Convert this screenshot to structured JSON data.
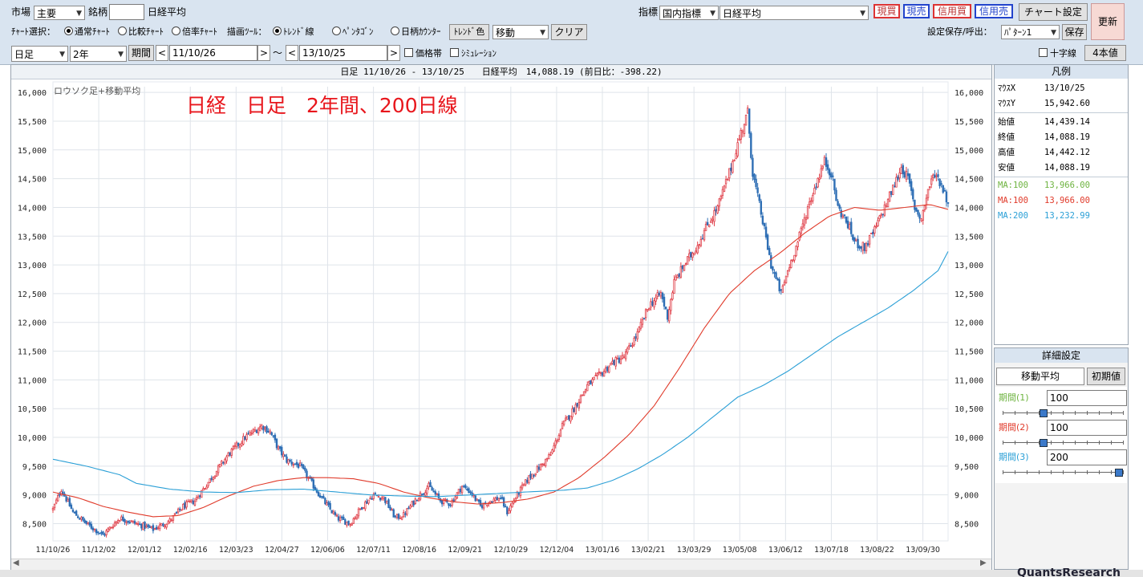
{
  "toolbar1": {
    "market_label": "市場",
    "market_value": "主要",
    "symbol_label": "銘柄",
    "symbol_value": "",
    "symbol_name": "日経平均",
    "indicator_label": "指標",
    "indicator_category": "国内指標",
    "indicator_value": "日経平均",
    "buttons": [
      "現買",
      "現売",
      "信用買",
      "信用売"
    ],
    "chart_settings": "チャート設定",
    "refresh": "更新"
  },
  "toolbar2": {
    "chart_select_label": "ﾁｬｰﾄ選択：",
    "chart_modes": [
      "通常ﾁｬｰﾄ",
      "比較ﾁｬｰﾄ",
      "倍率ﾁｬｰﾄ"
    ],
    "draw_tool_label": "描画ﾂｰﾙ：",
    "draw_tools": [
      "ﾄﾚﾝﾄﾞ線",
      "ﾍﾟﾝﾀｺﾞﾝ",
      "日柄ｶｳﾝﾀｰ"
    ],
    "trend_color": "ﾄﾚﾝﾄﾞ色",
    "mode_value": "移動",
    "clear": "クリア",
    "save_label": "設定保存/呼出：",
    "pattern_value": "ﾊﾟﾀｰﾝ1",
    "save_button": "保存"
  },
  "toolbar3": {
    "bar_type": "日足",
    "span": "2年",
    "period_button": "期間",
    "prev": "<",
    "next": ">",
    "start_date": "11/10/26",
    "tilde": "～",
    "end_date": "13/10/25",
    "price_band": "価格帯",
    "simulation": "ｼﾐｭﾚｰｼｮﾝ",
    "crosshair": "十字線",
    "four_values": "4本値"
  },
  "chart_header": "日足 11/10/26 - 13/10/25　　日経平均　14,088.19 (前日比：-398.22)",
  "chart_type_label": "ロウソク足+移動平均",
  "annotation": "日経　日足　2年間、200日線",
  "legend": {
    "title": "凡例",
    "mouse_x_label": "ﾏｳｽX",
    "mouse_x": "13/10/25",
    "mouse_y_label": "ﾏｳｽY",
    "mouse_y": "15,942.60",
    "open_label": "始値",
    "open": "14,439.14",
    "close_label": "終値",
    "close": "14,088.19",
    "high_label": "高値",
    "high": "14,442.12",
    "low_label": "安値",
    "low": "14,088.19",
    "ma1_label": "MA:100",
    "ma1": "13,966.00",
    "ma1_color": "#6db33f",
    "ma2_label": "MA:100",
    "ma2": "13,966.00",
    "ma2_color": "#e03a2a",
    "ma3_label": "MA:200",
    "ma3": "13,232.99",
    "ma3_color": "#2a9fd6"
  },
  "details": {
    "title": "詳細設定",
    "tab": "移動平均",
    "reset": "初期値",
    "period1_label": "期間(1)",
    "period1": "100",
    "period2_label": "期間(2)",
    "period2": "100",
    "period3_label": "期間(3)",
    "period3": "200",
    "period1_color": "#6db33f",
    "period2_color": "#e03a2a",
    "period3_color": "#2a9fd6",
    "slider1": 0.33,
    "slider2": 0.33,
    "slider3": 1.0
  },
  "bottom_watermark": "QuantsResearch",
  "chart_data": {
    "type": "candlestick",
    "ylim": [
      8200,
      16100
    ],
    "yticks": [
      8500,
      9000,
      9500,
      10000,
      10500,
      11000,
      11500,
      12000,
      12500,
      13000,
      13500,
      14000,
      14500,
      15000,
      15500,
      16000
    ],
    "ytick_labels": [
      "8,500",
      "9,000",
      "9,500",
      "10,000",
      "10,500",
      "11,000",
      "11,500",
      "12,000",
      "12,500",
      "13,000",
      "13,500",
      "14,000",
      "14,500",
      "15,000",
      "15,500",
      "16,000"
    ],
    "xtick_labels": [
      "11/10/26",
      "11/12/02",
      "12/01/12",
      "12/02/16",
      "12/03/23",
      "12/04/27",
      "12/06/06",
      "12/07/11",
      "12/08/16",
      "12/09/21",
      "12/10/29",
      "12/12/04",
      "13/01/16",
      "13/02/21",
      "13/03/29",
      "13/05/08",
      "13/06/12",
      "13/07/18",
      "13/08/22",
      "13/09/30"
    ],
    "close_path": [
      [
        0,
        8750
      ],
      [
        5,
        9100
      ],
      [
        12,
        8700
      ],
      [
        20,
        8500
      ],
      [
        30,
        8300
      ],
      [
        40,
        8600
      ],
      [
        50,
        8500
      ],
      [
        60,
        8400
      ],
      [
        70,
        8550
      ],
      [
        78,
        8800
      ],
      [
        85,
        8900
      ],
      [
        95,
        9300
      ],
      [
        105,
        9700
      ],
      [
        115,
        10000
      ],
      [
        125,
        10200
      ],
      [
        130,
        10100
      ],
      [
        135,
        9800
      ],
      [
        140,
        9600
      ],
      [
        148,
        9500
      ],
      [
        155,
        9200
      ],
      [
        162,
        8900
      ],
      [
        170,
        8600
      ],
      [
        178,
        8500
      ],
      [
        185,
        8800
      ],
      [
        192,
        9000
      ],
      [
        198,
        8950
      ],
      [
        205,
        8600
      ],
      [
        210,
        8650
      ],
      [
        218,
        8950
      ],
      [
        225,
        9150
      ],
      [
        232,
        8900
      ],
      [
        238,
        8850
      ],
      [
        245,
        9150
      ],
      [
        250,
        9050
      ],
      [
        256,
        8800
      ],
      [
        262,
        8900
      ],
      [
        268,
        8950
      ],
      [
        272,
        8700
      ],
      [
        278,
        9000
      ],
      [
        285,
        9300
      ],
      [
        292,
        9500
      ],
      [
        298,
        9700
      ],
      [
        305,
        10200
      ],
      [
        312,
        10500
      ],
      [
        320,
        10900
      ],
      [
        328,
        11100
      ],
      [
        335,
        11300
      ],
      [
        342,
        11400
      ],
      [
        350,
        11800
      ],
      [
        357,
        12300
      ],
      [
        364,
        12500
      ],
      [
        368,
        12100
      ],
      [
        372,
        12700
      ],
      [
        378,
        13000
      ],
      [
        385,
        13300
      ],
      [
        392,
        13700
      ],
      [
        398,
        14000
      ],
      [
        405,
        14600
      ],
      [
        412,
        15300
      ],
      [
        416,
        15650
      ],
      [
        419,
        14600
      ],
      [
        424,
        13900
      ],
      [
        430,
        13000
      ],
      [
        436,
        12500
      ],
      [
        440,
        12900
      ],
      [
        446,
        13400
      ],
      [
        452,
        14000
      ],
      [
        458,
        14500
      ],
      [
        462,
        14800
      ],
      [
        466,
        14600
      ],
      [
        470,
        14000
      ],
      [
        476,
        13700
      ],
      [
        480,
        13400
      ],
      [
        486,
        13300
      ],
      [
        492,
        13600
      ],
      [
        498,
        14000
      ],
      [
        504,
        14400
      ],
      [
        508,
        14700
      ],
      [
        512,
        14500
      ],
      [
        516,
        14000
      ],
      [
        520,
        13800
      ],
      [
        524,
        14300
      ],
      [
        528,
        14600
      ],
      [
        532,
        14400
      ],
      [
        536,
        14088
      ]
    ],
    "series": [
      {
        "name": "MA:100",
        "color": "#e03a2a",
        "points": [
          [
            0,
            9050
          ],
          [
            15,
            8950
          ],
          [
            30,
            8800
          ],
          [
            45,
            8700
          ],
          [
            60,
            8620
          ],
          [
            75,
            8640
          ],
          [
            90,
            8780
          ],
          [
            105,
            8980
          ],
          [
            120,
            9150
          ],
          [
            135,
            9250
          ],
          [
            150,
            9300
          ],
          [
            165,
            9300
          ],
          [
            180,
            9280
          ],
          [
            195,
            9200
          ],
          [
            210,
            9050
          ],
          [
            225,
            8950
          ],
          [
            240,
            8880
          ],
          [
            255,
            8840
          ],
          [
            270,
            8870
          ],
          [
            285,
            8930
          ],
          [
            300,
            9050
          ],
          [
            315,
            9300
          ],
          [
            330,
            9650
          ],
          [
            345,
            10050
          ],
          [
            360,
            10550
          ],
          [
            375,
            11200
          ],
          [
            390,
            11900
          ],
          [
            405,
            12500
          ],
          [
            420,
            12900
          ],
          [
            435,
            13200
          ],
          [
            450,
            13550
          ],
          [
            465,
            13850
          ],
          [
            480,
            14000
          ],
          [
            495,
            13950
          ],
          [
            510,
            14000
          ],
          [
            525,
            14050
          ],
          [
            536,
            13966
          ]
        ]
      },
      {
        "name": "MA:200",
        "color": "#2a9fd6",
        "points": [
          [
            0,
            9620
          ],
          [
            20,
            9500
          ],
          [
            40,
            9350
          ],
          [
            50,
            9200
          ],
          [
            70,
            9100
          ],
          [
            90,
            9050
          ],
          [
            110,
            9040
          ],
          [
            130,
            9090
          ],
          [
            150,
            9100
          ],
          [
            170,
            9050
          ],
          [
            190,
            9000
          ],
          [
            210,
            8980
          ],
          [
            230,
            8970
          ],
          [
            250,
            9000
          ],
          [
            270,
            9030
          ],
          [
            290,
            9060
          ],
          [
            305,
            9080
          ],
          [
            320,
            9120
          ],
          [
            335,
            9250
          ],
          [
            350,
            9450
          ],
          [
            365,
            9700
          ],
          [
            380,
            10000
          ],
          [
            395,
            10350
          ],
          [
            410,
            10700
          ],
          [
            425,
            10900
          ],
          [
            440,
            11150
          ],
          [
            455,
            11450
          ],
          [
            470,
            11750
          ],
          [
            485,
            12000
          ],
          [
            500,
            12250
          ],
          [
            515,
            12550
          ],
          [
            530,
            12900
          ],
          [
            536,
            13233
          ]
        ]
      }
    ]
  }
}
